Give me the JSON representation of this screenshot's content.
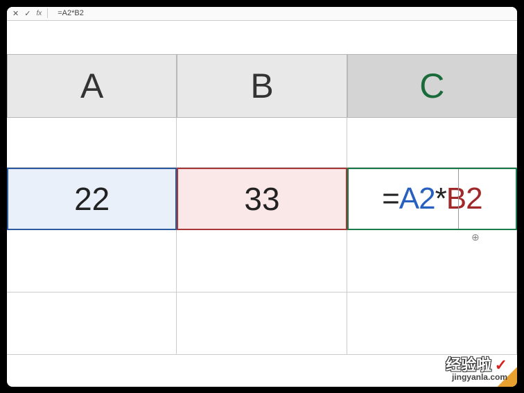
{
  "formula_bar": {
    "cancel": "✕",
    "confirm": "✓",
    "fx_label": "fx",
    "formula": "=A2*B2"
  },
  "columns": {
    "a": "A",
    "b": "B",
    "c": "C"
  },
  "cells": {
    "a2": "22",
    "b2": "33",
    "c2_formula": {
      "eq": "=",
      "ref1": "A2",
      "op": "*",
      "ref2": "B2"
    }
  },
  "watermark": {
    "main": "经验啦",
    "check": "✓",
    "sub": "jingyanla.com"
  },
  "chart_data": {
    "type": "table",
    "title": "Spreadsheet formula entry",
    "columns": [
      "A",
      "B",
      "C"
    ],
    "rows": [
      {
        "A": "",
        "B": "",
        "C": ""
      },
      {
        "A": 22,
        "B": 33,
        "C": "=A2*B2"
      }
    ],
    "active_cell": "C2",
    "formula_bar_value": "=A2*B2",
    "references": [
      {
        "cell": "A2",
        "color": "#2860c0"
      },
      {
        "cell": "B2",
        "color": "#a02828"
      }
    ]
  }
}
